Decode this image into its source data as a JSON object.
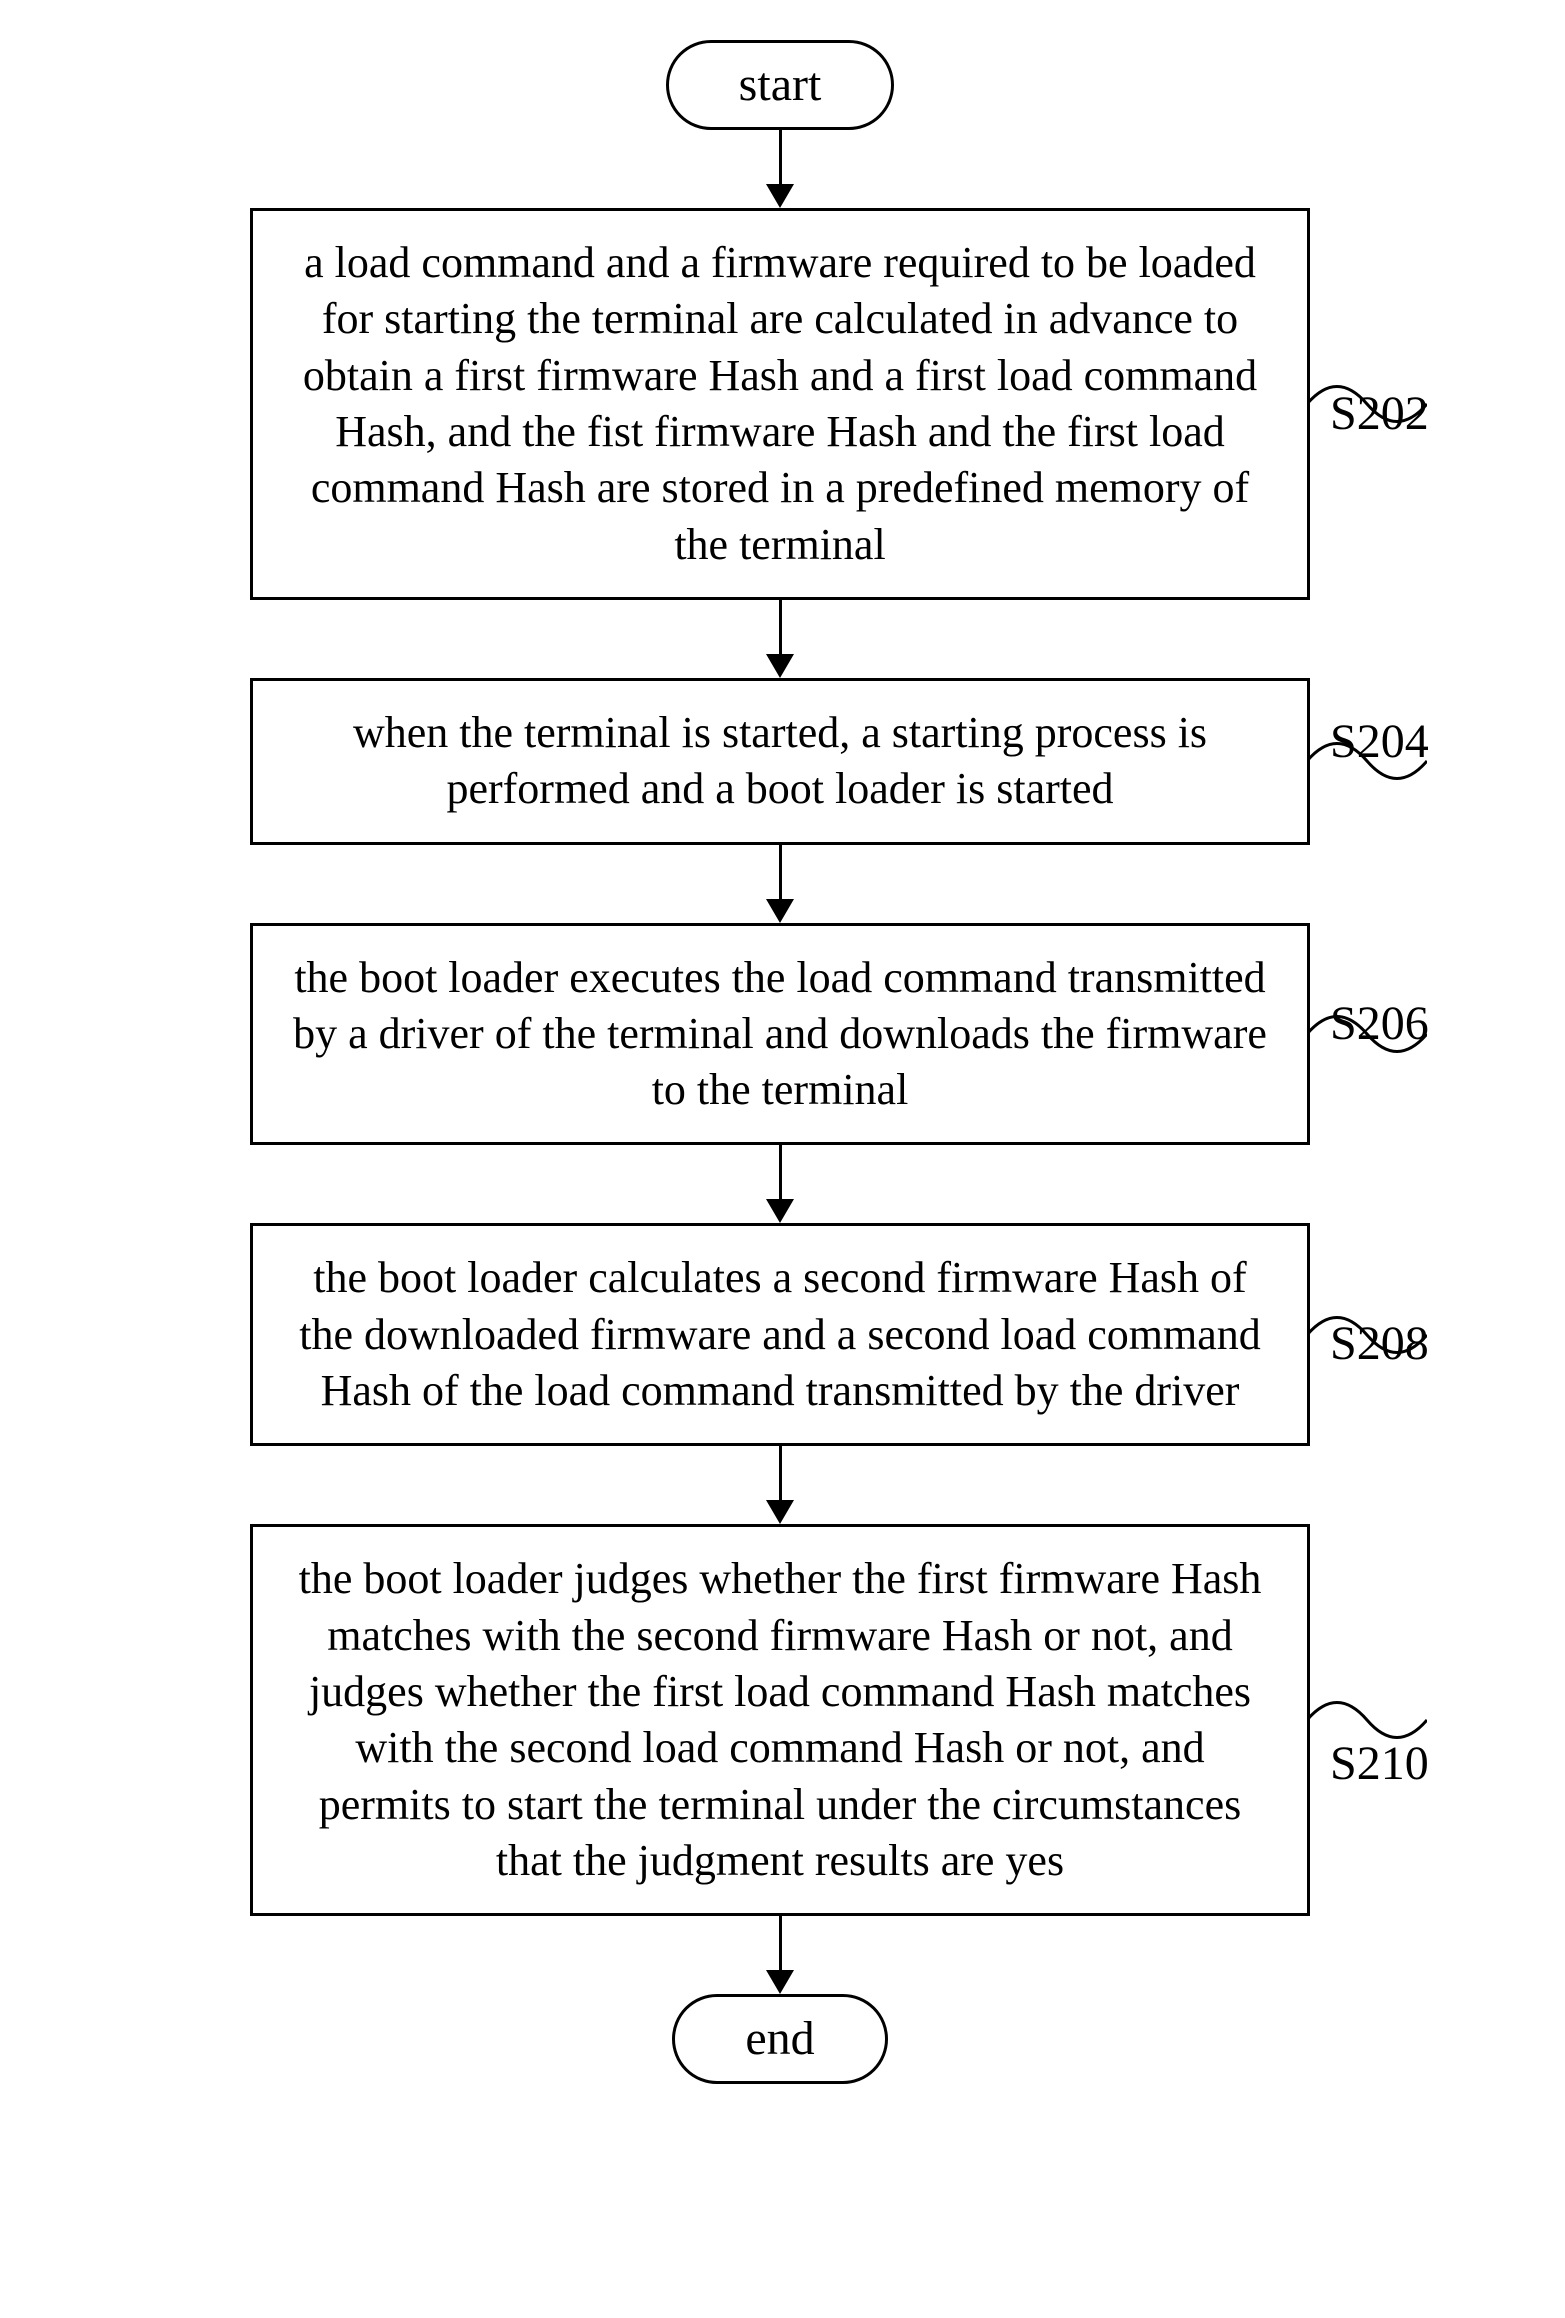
{
  "flowchart": {
    "start": "start",
    "end": "end",
    "steps": [
      {
        "id": "S202",
        "text": "a load command and a firmware required to be loaded for starting the terminal are calculated in advance to obtain a first firmware Hash and a first load command Hash, and the fist firmware Hash and the first load command Hash are stored in a predefined memory of the terminal"
      },
      {
        "id": "S204",
        "text": "when the terminal is started, a starting process is performed and a boot loader is started"
      },
      {
        "id": "S206",
        "text": "the boot loader executes the load command transmitted by a driver of the terminal and downloads the firmware to the terminal"
      },
      {
        "id": "S208",
        "text": "the boot loader calculates a second firmware Hash of the downloaded firmware and a second load command Hash of the load command transmitted by the driver"
      },
      {
        "id": "S210",
        "text": "the boot loader judges whether the first firmware Hash matches with the second firmware Hash or not, and judges whether the first load command Hash matches with the second load command Hash or not, and permits to start the terminal under the circumstances that the judgment results are yes"
      }
    ]
  }
}
